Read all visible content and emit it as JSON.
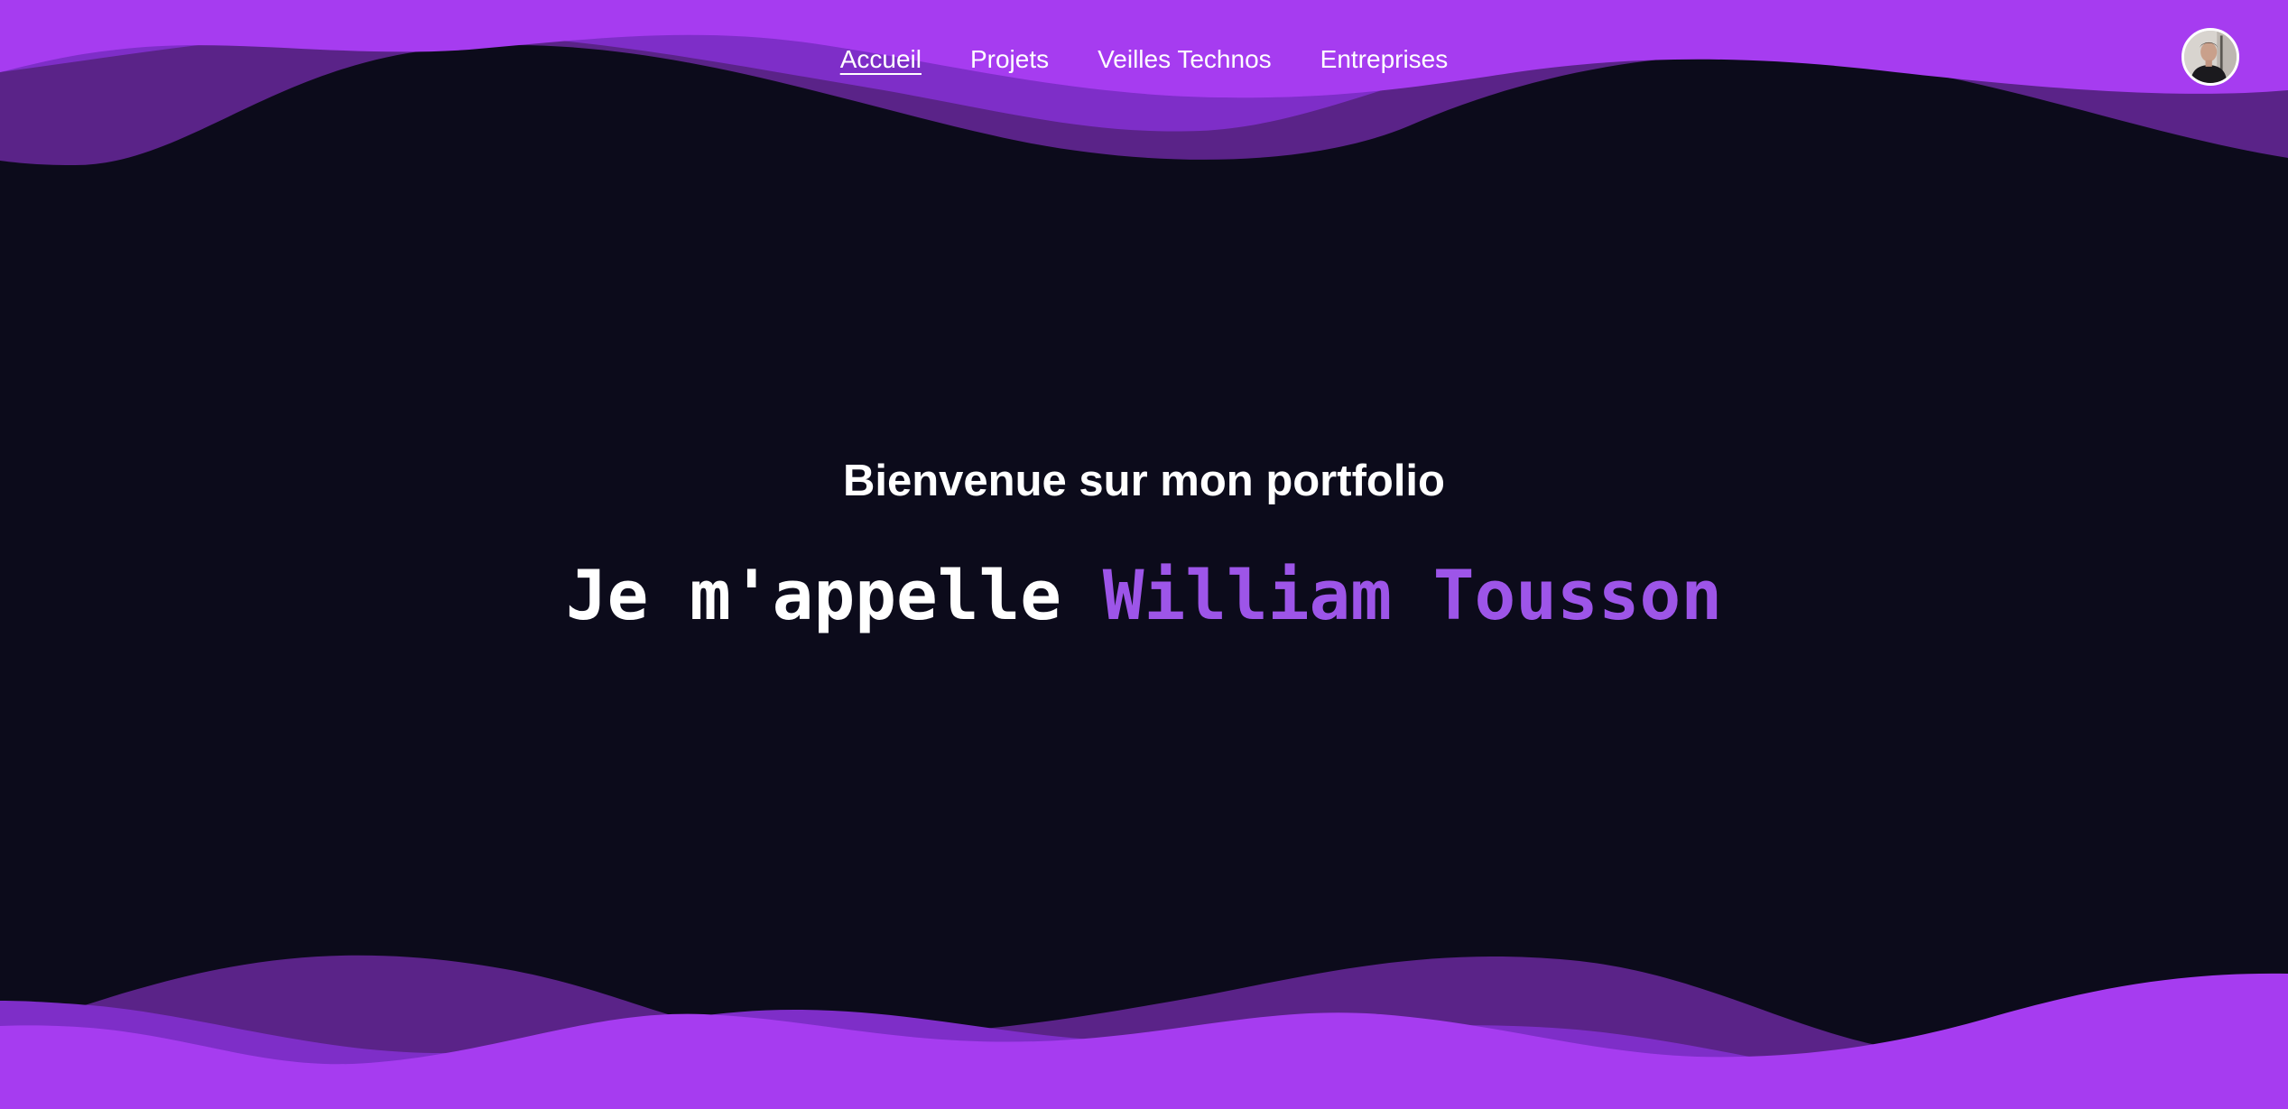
{
  "nav": {
    "items": [
      {
        "label": "Accueil",
        "active": true
      },
      {
        "label": "Projets",
        "active": false
      },
      {
        "label": "Veilles Technos",
        "active": false
      },
      {
        "label": "Entreprises",
        "active": false
      }
    ]
  },
  "avatar": {
    "icon": "profile-photo"
  },
  "hero": {
    "subtitle": "Bienvenue sur mon portfolio",
    "intro": "Je m'appelle ",
    "name": "William Tousson"
  },
  "colors": {
    "background": "#0c0b1b",
    "wave_light": "#a63cf0",
    "wave_mid": "#7e2ec8",
    "wave_dark": "#5a2388",
    "accent_name": "#9d55e8",
    "text": "#ffffff"
  }
}
